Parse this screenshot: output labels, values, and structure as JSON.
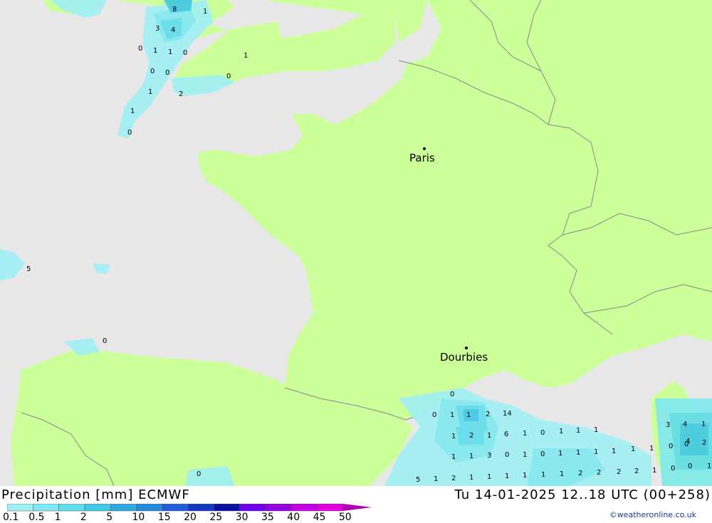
{
  "header": {
    "title": "Precipitation [mm] ECMWF",
    "timestamp": "Tu 14-01-2025 12..18 UTC (00+258)",
    "credit": "©weatheronline.co.uk"
  },
  "cities": [
    {
      "name": "Paris"
    },
    {
      "name": "Dourbies"
    }
  ],
  "legend": {
    "labels": [
      "0.1",
      "0.5",
      "1",
      "2",
      "5",
      "10",
      "15",
      "20",
      "25",
      "30",
      "35",
      "40",
      "45",
      "50"
    ],
    "colors": [
      "#a0f0f5",
      "#80e8f0",
      "#60dcea",
      "#40c8e6",
      "#32a8e0",
      "#2888dc",
      "#1e5ed8",
      "#1438c0",
      "#0a10a0",
      "#7000e8",
      "#9400e0",
      "#c000e0",
      "#e000d8",
      "#b000b0"
    ]
  },
  "colors": {
    "land": "#ccff99",
    "sea": "#e8e8e8",
    "border": "#888888"
  },
  "precip_values": [
    "8",
    "1",
    "3",
    "4",
    "0",
    "1",
    "1",
    "0",
    "0",
    "0",
    "1",
    "2",
    "1",
    "0",
    "1",
    "0",
    "0",
    "0",
    "1",
    "1",
    "2",
    "14",
    "1",
    "2",
    "1",
    "6",
    "1",
    "0",
    "1",
    "1",
    "1",
    "1",
    "1",
    "3",
    "0",
    "1",
    "0",
    "1",
    "1",
    "1",
    "1",
    "1",
    "1",
    "0",
    "0",
    "2",
    "5",
    "1",
    "2",
    "1",
    "1",
    "1",
    "1",
    "1",
    "1",
    "2",
    "2",
    "2",
    "2",
    "1",
    "0",
    "0",
    "1",
    "3",
    "4",
    "1",
    "4",
    "5",
    "0",
    "0"
  ]
}
